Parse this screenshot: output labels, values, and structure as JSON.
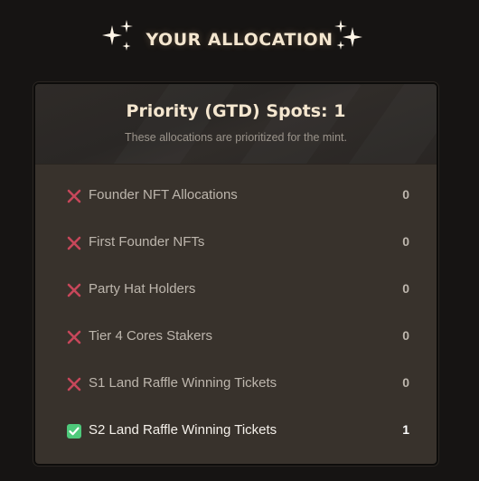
{
  "heading": {
    "title": "YOUR ALLOCATION",
    "left_icon": "sparkle-icon",
    "right_icon": "sparkle-icon"
  },
  "card": {
    "title": "Priority (GTD) Spots: 1",
    "subtitle": "These allocations are prioritized for the mint.",
    "rows": [
      {
        "label": "Founder NFT Allocations",
        "value": "0",
        "status": "cross-icon"
      },
      {
        "label": "First Founder NFTs",
        "value": "0",
        "status": "cross-icon"
      },
      {
        "label": "Party Hat Holders",
        "value": "0",
        "status": "cross-icon"
      },
      {
        "label": "Tier 4 Cores Stakers",
        "value": "0",
        "status": "cross-icon"
      },
      {
        "label": "S1 Land Raffle Winning Tickets",
        "value": "0",
        "status": "cross-icon"
      },
      {
        "label": "S2 Land Raffle Winning Tickets",
        "value": "1",
        "status": "check-icon"
      }
    ]
  },
  "colors": {
    "background": "#161413",
    "card": "#38322c",
    "title": "#f4e6cf",
    "cross": "#c7475a",
    "check": "#4ec97b"
  }
}
